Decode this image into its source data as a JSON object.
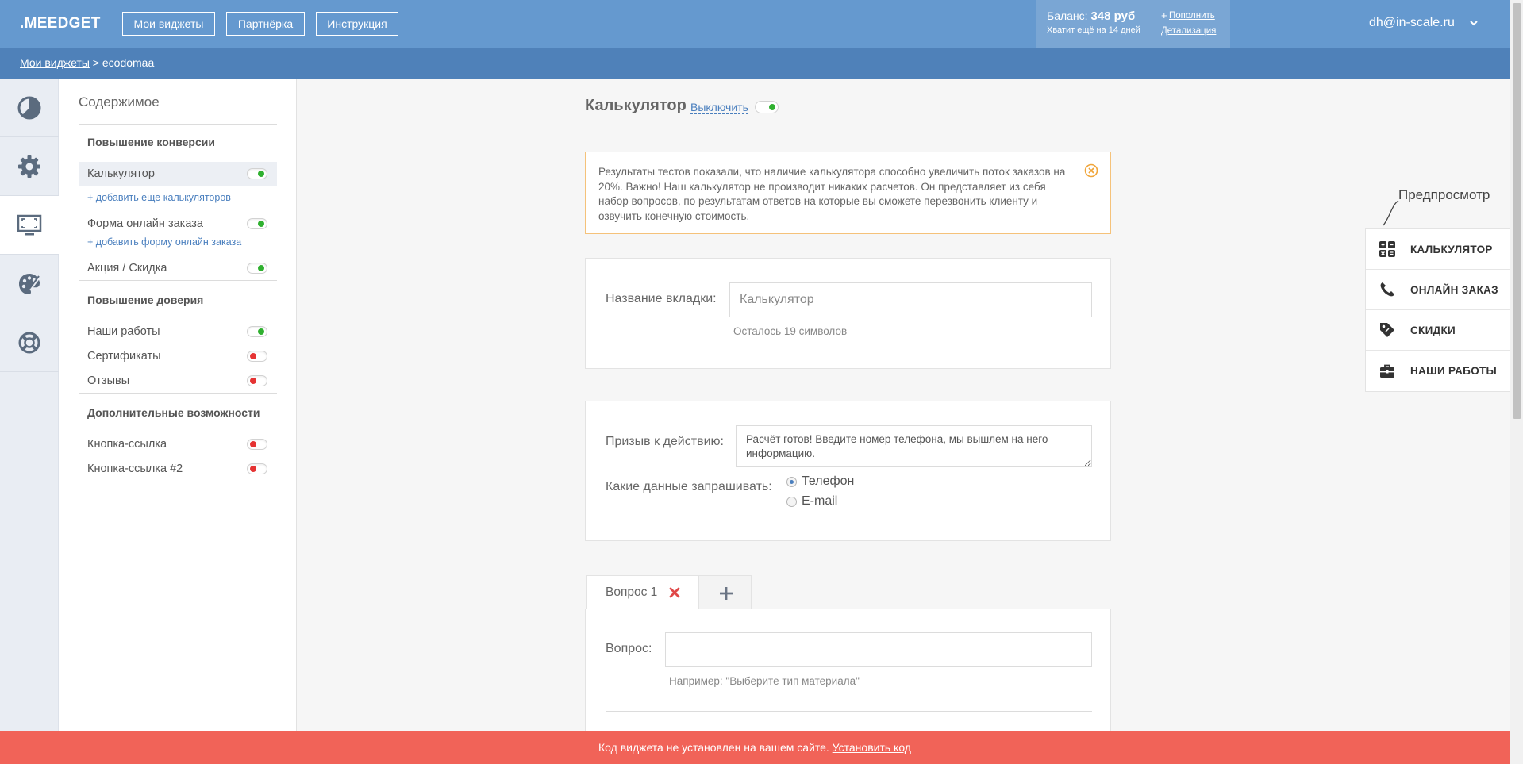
{
  "header": {
    "logo": ".MEEDGET",
    "nav": [
      "Мои виджеты",
      "Партнёрка",
      "Инструкция"
    ],
    "balance_label": "Баланс:",
    "balance_value": "348 руб",
    "balance_days": "Хватит ещё на 14 дней",
    "topup_plus": "+",
    "topup_link": "Пополнить",
    "details_link": "Детализация",
    "user_email": "dh@in-scale.ru"
  },
  "breadcrumb": {
    "root": "Мои виджеты",
    "separator": " > ",
    "current": "ecodomaa"
  },
  "sidebar": {
    "title": "Содержимое",
    "sections": [
      {
        "title": "Повышение конверсии"
      },
      {
        "title": "Повышение доверия"
      },
      {
        "title": "Дополнительные возможности"
      }
    ],
    "items": [
      {
        "label": "Калькулятор",
        "enabled": true
      },
      {
        "label": "Форма онлайн заказа",
        "enabled": true
      },
      {
        "label": "Акция / Скидка",
        "enabled": true
      },
      {
        "label": "Наши работы",
        "enabled": true
      },
      {
        "label": "Сертификаты",
        "enabled": false
      },
      {
        "label": "Отзывы",
        "enabled": false
      },
      {
        "label": "Кнопка-ссылка",
        "enabled": false
      },
      {
        "label": "Кнопка-ссылка #2",
        "enabled": false
      }
    ],
    "add_calc": "+ добавить еще калькуляторов",
    "add_form": "+ добавить форму онлайн заказа"
  },
  "main": {
    "title": "Калькулятор",
    "off_link": "Выключить",
    "alert": "Результаты тестов показали, что наличие калькулятора способно увеличить поток заказов на 20%. Важно! Наш калькулятор не производит никаких расчетов. Он представляет из себя набор вопросов, по результатам ответов на которые вы сможете перезвонить клиенту и озвучить конечную стоимость.",
    "tab_name_label": "Название вкладки:",
    "tab_name_placeholder": "Калькулятор",
    "tab_name_hint": "Осталось 19 символов",
    "cta_label": "Призыв к действию:",
    "cta_value": "Расчёт готов! Введите номер телефона, мы вышлем на него информацию.",
    "data_label": "Какие данные запрашивать:",
    "radio_options": [
      "Телефон",
      "E-mail"
    ],
    "question_tab": "Вопрос 1",
    "question_label": "Вопрос:",
    "question_hint": "Например: \"Выберите тип материала\""
  },
  "preview": {
    "label": "Предпросмотр",
    "items": [
      "КАЛЬКУЛЯТОР",
      "ОНЛАЙН ЗАКАЗ",
      "СКИДКИ",
      "НАШИ РАБОТЫ"
    ]
  },
  "banner": {
    "text": "Код виджета не установлен на вашем сайте.",
    "link": "Установить код"
  },
  "colors": {
    "header": "#6599cf",
    "breadcrumb": "#4f81b9",
    "banner": "#f16358",
    "toggle_on": "#2fb02f",
    "toggle_off": "#e53333",
    "link": "#4a7fbe"
  }
}
